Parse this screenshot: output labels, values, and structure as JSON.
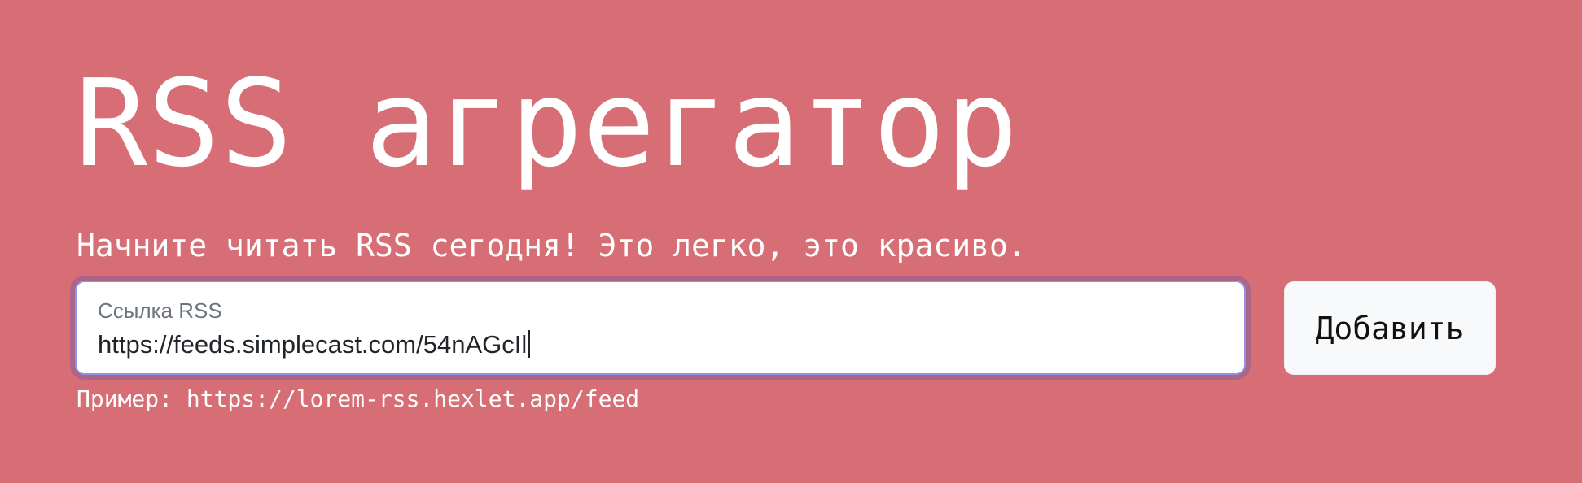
{
  "header": {
    "title": "RSS агрегатор",
    "lead": "Начните читать RSS сегодня! Это легко, это красиво."
  },
  "form": {
    "label": "Ссылка RSS",
    "value": "https://feeds.simplecast.com/54nAGcIl",
    "button_label": "Добавить",
    "example_text": "Пример: https://lorem-rss.hexlet.app/feed"
  },
  "colors": {
    "background": "#d76e76",
    "text": "#ffffff",
    "input_focus_border": "#8f93e8",
    "button_background": "#f8f9fa"
  }
}
